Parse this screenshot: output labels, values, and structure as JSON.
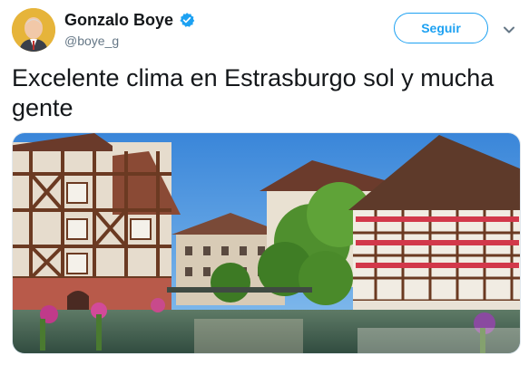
{
  "tweet": {
    "author": {
      "display_name": "Gonzalo Boye",
      "handle": "@boye_g",
      "verified": true
    },
    "follow_label": "Seguir",
    "text": "Excelente clima en Estrasburgo sol y mucha gente",
    "media": {
      "subject": "half-timbered houses along a canal under blue sky"
    }
  },
  "colors": {
    "accent": "#1da1f2",
    "text": "#14171a",
    "secondary_text": "#657786"
  },
  "icons": {
    "verified": "verified-badge-icon",
    "menu": "chevron-down-icon"
  }
}
